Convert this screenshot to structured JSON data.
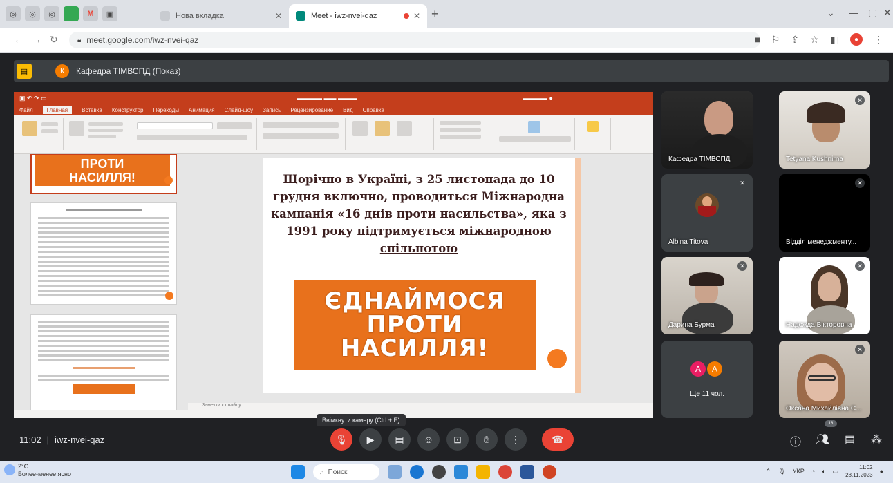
{
  "browser": {
    "tabs": [
      {
        "title": "Нова вкладка",
        "active": false
      },
      {
        "title": "Meet - iwz-nvei-qaz",
        "active": true
      }
    ],
    "url": "meet.google.com/iwz-nvei-qaz",
    "colors": {
      "tabbar": "#dee1e6",
      "addr": "#ffffff"
    }
  },
  "presentation": {
    "presenter_initial": "К",
    "title": "Кафедра ТІМВСПД (Показ)"
  },
  "ppt": {
    "tabs": [
      "Файл",
      "Главная",
      "Вставка",
      "Конструктор",
      "Переходы",
      "Анимация",
      "Слайд-шоу",
      "Запись",
      "Рецензирование",
      "Вид",
      "Справка"
    ],
    "thumb1_line1": "ПРОТИ",
    "thumb1_line2": "НАСИЛЛЯ!",
    "slide": {
      "text_plain": "Щорічно в Україні, з 25 листопада до 10 грудня включно, проводиться Міжнародна кампанія «16 днів проти насильства», яка з 1991 року підтримується",
      "text_underline": "міжнародною спільнотою",
      "banner_line1": "ЄДНАЙМОСЯ",
      "banner_line2": "ПРОТИ",
      "banner_line3": "НАСИЛЛЯ!"
    },
    "notes_placeholder": "Заметки к слайду"
  },
  "participants": [
    {
      "name": "Кафедра ТІМВСПД",
      "muted": false
    },
    {
      "name": "Tetyana Kushnirna",
      "muted": true
    },
    {
      "name": "Albina Titova",
      "muted": true
    },
    {
      "name": "Відділ менеджменту...",
      "muted": true
    },
    {
      "name": "Дарина Бурма",
      "muted": true
    },
    {
      "name": "Надєжда Вікторовна",
      "muted": true
    },
    {
      "name": "Ще 11 чол.",
      "avatars": [
        "А",
        "А"
      ]
    },
    {
      "name": "Оксана Михайлівна С...",
      "muted": true
    }
  ],
  "meeting": {
    "time": "11:02",
    "code": "iwz-nvei-qaz",
    "tooltip": "Ввімкнути камеру (Ctrl + E)",
    "participants_badge": "18"
  },
  "taskbar": {
    "temp": "2°C",
    "weather": "Более-менее ясно",
    "search": "Поиск",
    "lang": "УКР",
    "time": "11:02",
    "date": "28.11.2023"
  }
}
